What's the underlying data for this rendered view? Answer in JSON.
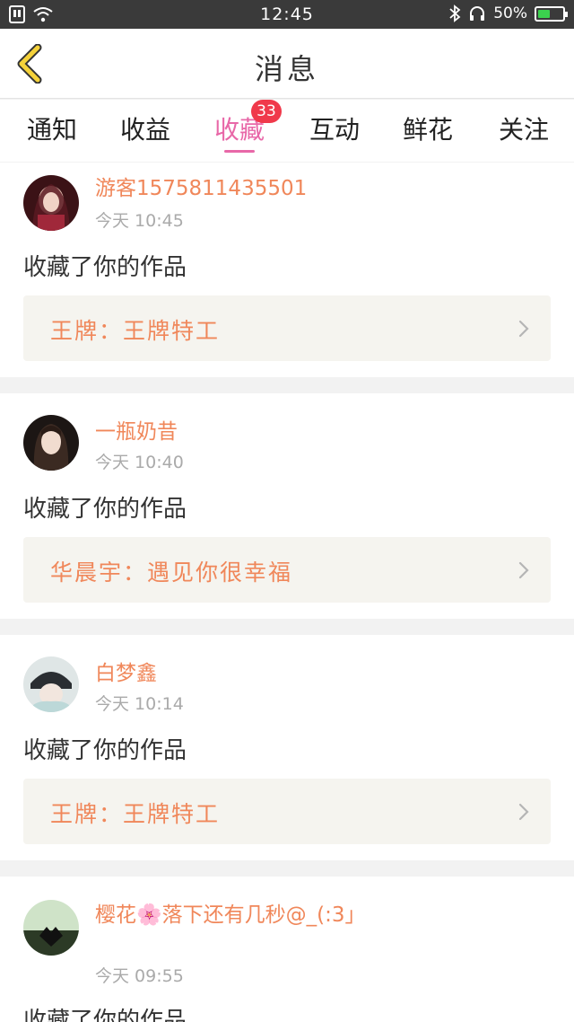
{
  "status_bar": {
    "time": "12:45",
    "battery": "50%",
    "battery_level": 0.5,
    "icons": [
      "sim-icon",
      "wifi-icon",
      "bluetooth-icon",
      "headset-icon",
      "battery-icon"
    ]
  },
  "header": {
    "title": "消息",
    "back_icon": "chevron-left-icon"
  },
  "tabs": [
    {
      "label": "通知"
    },
    {
      "label": "收益"
    },
    {
      "label": "收藏",
      "badge": "33",
      "active": true
    },
    {
      "label": "互动"
    },
    {
      "label": "鲜花"
    },
    {
      "label": "关注"
    }
  ],
  "colors": {
    "accent_pink": "#e868a8",
    "name_orange": "#f0875a",
    "badge_red": "#f0394b",
    "status_bar": "#3a3a3a"
  },
  "messages": [
    {
      "name": "游客1575811435501",
      "time": "今天 10:45",
      "action": "收藏了你的作品",
      "work": "王牌：王牌特工"
    },
    {
      "name": "一瓶奶昔",
      "time": "今天 10:40",
      "action": "收藏了你的作品",
      "work": "华晨宇：遇见你很幸福"
    },
    {
      "name": "白梦鑫",
      "time": "今天 10:14",
      "action": "收藏了你的作品",
      "work": "王牌：王牌特工"
    },
    {
      "name": "樱花🌸落下还有几秒@_(:3」",
      "time": "今天 09:55",
      "action": "收藏了你的作品"
    }
  ]
}
